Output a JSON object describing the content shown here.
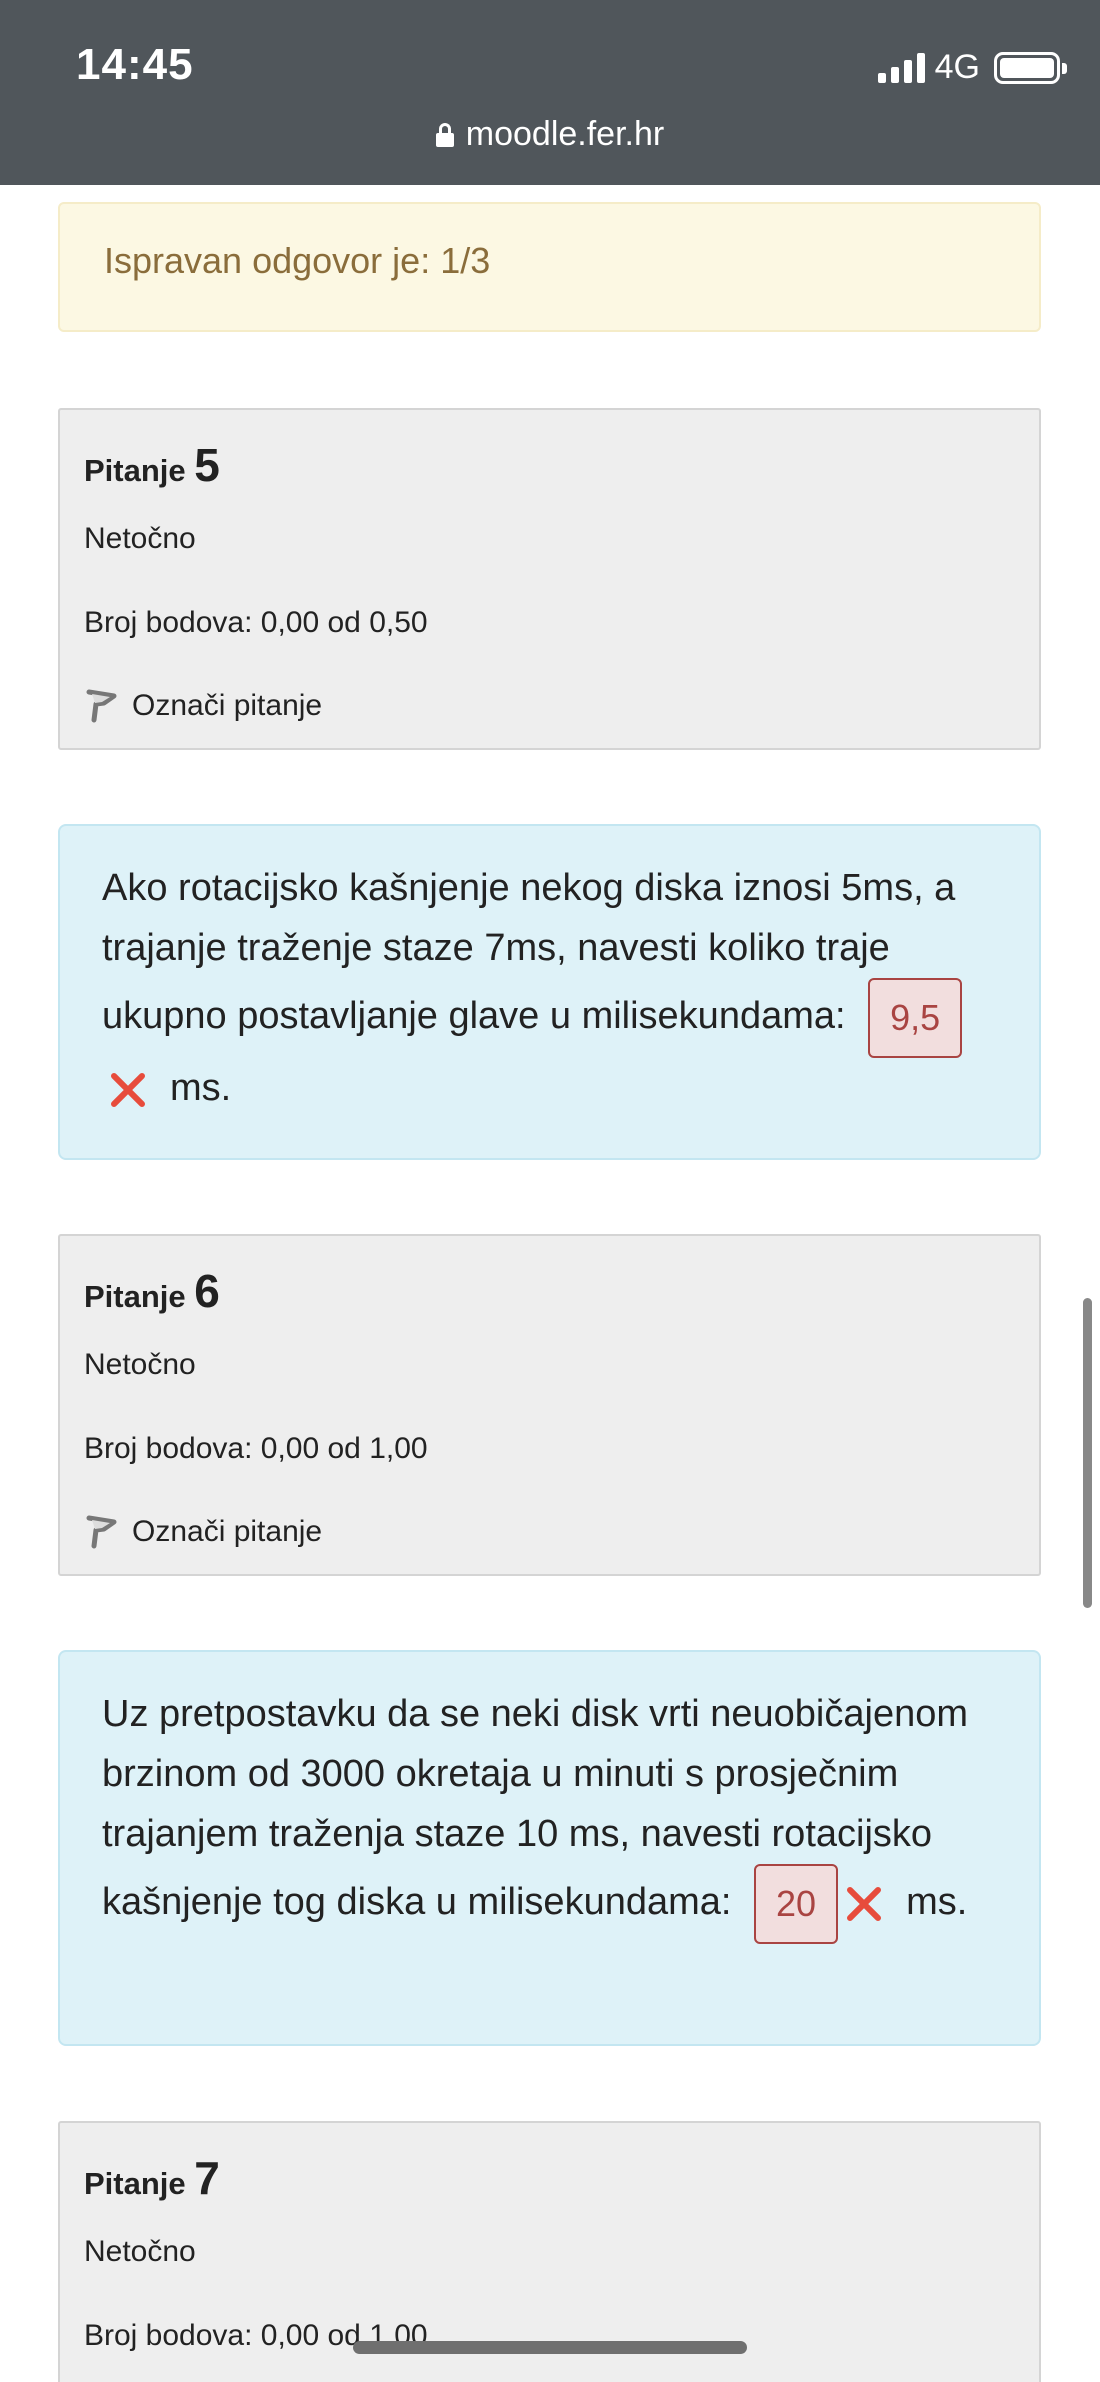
{
  "status_bar": {
    "time": "14:45",
    "network": "4G",
    "url": "moodle.fer.hr"
  },
  "correct_answer_text": "Ispravan odgovor je: 1/3",
  "questions": [
    {
      "label": "Pitanje",
      "number": "5",
      "state": "Netočno",
      "grade": "Broj bodova: 0,00 od 0,50",
      "flag_label": "Označi pitanje",
      "text": "Ako rotacijsko kašnjenje nekog diska iznosi 5ms, a trajanje traženje staze 7ms, navesti koliko traje ukupno postavljanje glave u milisekundama:",
      "answer": "9,5",
      "unit": "ms."
    },
    {
      "label": "Pitanje",
      "number": "6",
      "state": "Netočno",
      "grade": "Broj bodova: 0,00 od 1,00",
      "flag_label": "Označi pitanje",
      "text": "Uz pretpostavku da se neki disk vrti neuobičajenom brzinom od 3000 okretaja u minuti s prosječnim trajanjem traženja staze 10 ms, navesti rotacijsko kašnjenje tog diska u milisekundama:",
      "answer": "20",
      "unit": "ms."
    },
    {
      "label": "Pitanje",
      "number": "7",
      "state": "Netočno",
      "grade": "Broj bodova: 0,00 od 1,00"
    }
  ],
  "colors": {
    "status_bar": "#50565b",
    "warning_bg": "#fcf8e3",
    "warning_text": "#8a6d3b",
    "info_bg": "#eeeeee",
    "content_bg": "#def2f8",
    "incorrect": "#a94442",
    "x_mark": "#e74c3c"
  }
}
